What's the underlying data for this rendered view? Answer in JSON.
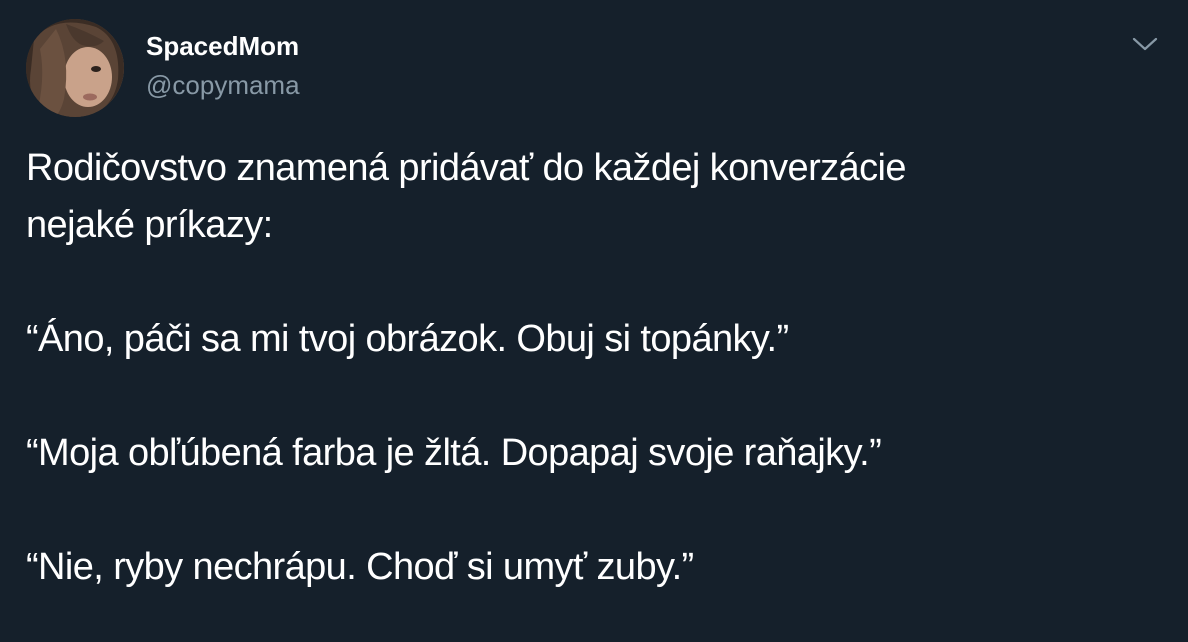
{
  "tweet": {
    "author": {
      "display_name": "SpacedMom",
      "handle": "@copymama",
      "avatar_icon": "profile-photo-avatar"
    },
    "menu_icon": "chevron-down-icon",
    "text_lines": [
      "Rodičovstvo znamená pridávať do každej konverzácie",
      "nejaké príkazy:",
      "“Áno, páči sa mi tvoj obrázok. Obuj si topánky.”",
      "“Moja obľúbená farba je žltá. Dopapaj svoje raňajky.”",
      "“Nie, ryby nechrápu. Choď si umyť zuby.”"
    ],
    "colors": {
      "background": "#15202b",
      "text": "#ffffff",
      "secondary_text": "#8899a6"
    }
  }
}
